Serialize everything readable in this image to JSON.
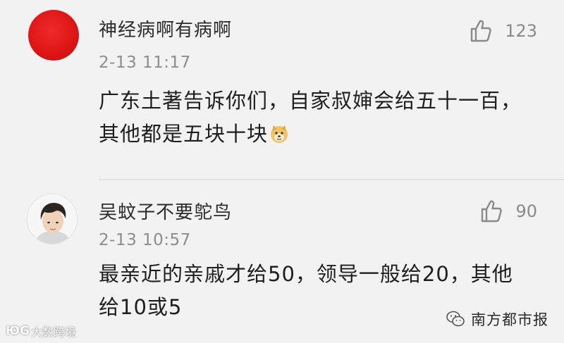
{
  "comments": [
    {
      "username": "神经病啊有病啊",
      "time": "2-13 11:17",
      "likes": "123",
      "content_line1": "广东土著告诉你们，自家叔婶会给五十一百，",
      "content_line2": "其他都是五块十块",
      "emoji": "doge-emoji-icon",
      "avatar_color": "#dd1414"
    },
    {
      "username": "吴蚊子不要鸵鸟",
      "time": "2-13 10:57",
      "likes": "90",
      "content_line1": "最亲近的亲戚才给50，领导一般给20，其他",
      "content_line2": "给10或5"
    }
  ],
  "watermarks": {
    "left_logo": "ЮG",
    "left_text": "大数跨境",
    "right_text": "南方都市报"
  },
  "colors": {
    "background": "#f2f2f2",
    "meta_text": "#8d8d8d",
    "body_text": "#1e1e1e"
  }
}
